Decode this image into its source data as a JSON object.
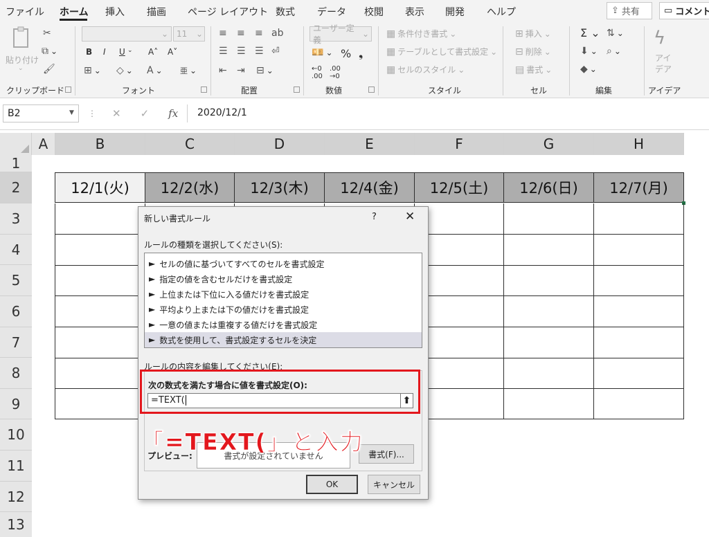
{
  "menu": {
    "tabs": [
      "ファイル",
      "ホーム",
      "挿入",
      "描画",
      "ページ レイアウト",
      "数式",
      "データ",
      "校閲",
      "表示",
      "開発",
      "ヘルプ"
    ],
    "active_tab": "ホーム",
    "share_label": "共有",
    "comment_label": "コメント"
  },
  "ribbon": {
    "clipboard": {
      "paste": "貼り付け",
      "label": "クリップボード"
    },
    "font": {
      "size": "11",
      "label": "フォント",
      "bold": "B",
      "italic": "I",
      "underline": "U"
    },
    "alignment": {
      "label": "配置"
    },
    "number": {
      "format": "ユーザー定義",
      "label": "数値"
    },
    "styles": {
      "conditional": "条件付き書式",
      "table": "テーブルとして書式設定",
      "cell_styles": "セルのスタイル",
      "label": "スタイル"
    },
    "cells": {
      "insert": "挿入",
      "delete": "削除",
      "format": "書式",
      "label": "セル"
    },
    "editing": {
      "label": "編集"
    },
    "ideas": {
      "button": "アイデア",
      "label": "アイデア"
    }
  },
  "formula_bar": {
    "name_box": "B2",
    "fx": "fx",
    "value": "2020/12/1"
  },
  "sheet": {
    "columns": [
      "A",
      "B",
      "C",
      "D",
      "E",
      "F",
      "G",
      "H"
    ],
    "rows": [
      "1",
      "2",
      "3",
      "4",
      "5",
      "6",
      "7",
      "8",
      "9",
      "10",
      "11",
      "12",
      "13"
    ],
    "row2": [
      "12/1(火)",
      "12/2(水)",
      "12/3(木)",
      "12/4(金)",
      "12/5(土)",
      "12/6(日)",
      "12/7(月)"
    ]
  },
  "dialog": {
    "title": "新しい書式ルール",
    "help": "?",
    "close": "✕",
    "rule_type_label": "ルールの種類を選択してください(S):",
    "rule_types": [
      "セルの値に基づいてすべてのセルを書式設定",
      "指定の値を含むセルだけを書式設定",
      "上位または下位に入る値だけを書式設定",
      "平均より上または下の値だけを書式設定",
      "一意の値または重複する値だけを書式設定",
      "数式を使用して、書式設定するセルを決定"
    ],
    "selected_rule_index": 5,
    "edit_label": "ルールの内容を編集してください(E):",
    "formula_label": "次の数式を満たす場合に値を書式設定(O):",
    "formula_value": "=TEXT(",
    "preview_label": "プレビュー:",
    "preview_text": "書式が設定されていません",
    "format_button": "書式(F)...",
    "ok_button": "OK",
    "cancel_button": "キャンセル"
  },
  "annotation": {
    "text": "「=TEXT(」と入力",
    "color": "#e3171d"
  }
}
